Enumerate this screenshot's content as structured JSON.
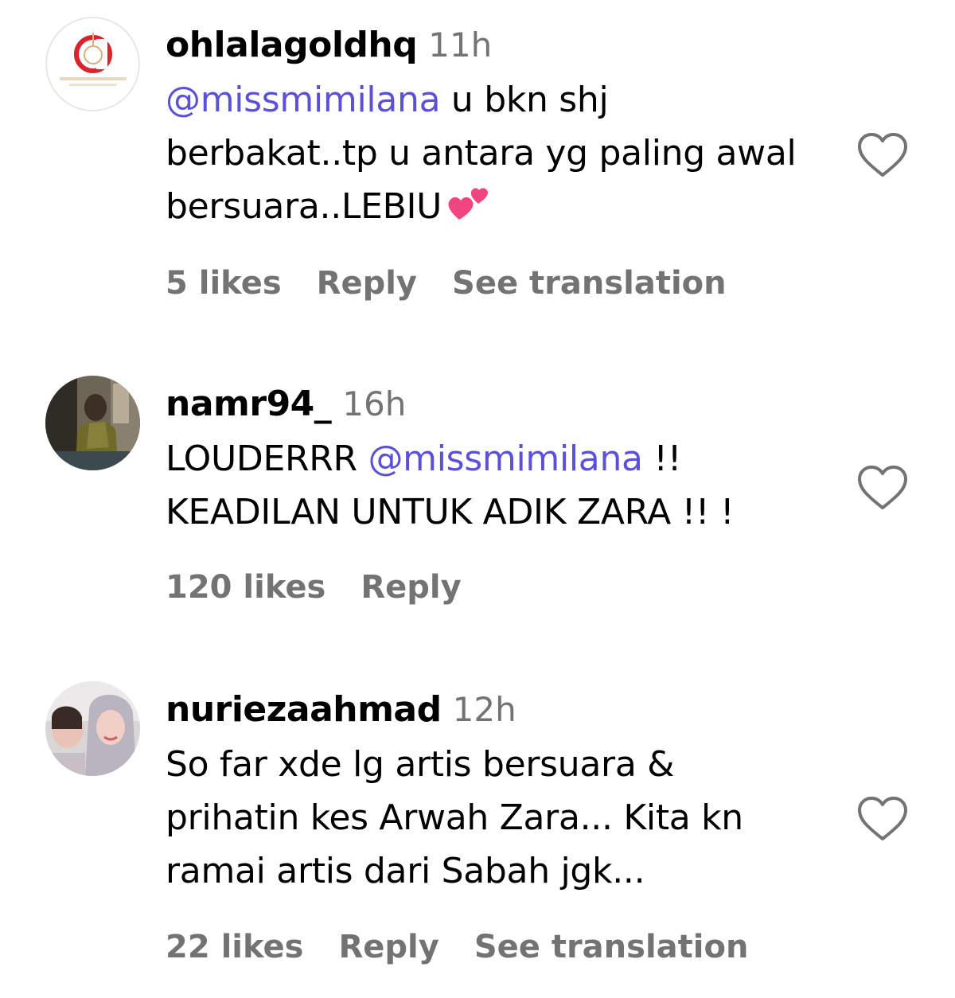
{
  "comments": [
    {
      "username": "ohlalagoldhq",
      "time": "11h",
      "mention": "@missmimilana",
      "text_after_mention": " u bkn shj",
      "line2": "berbakat..tp u antara yg paling awal",
      "line3": "bersuara..LEBIU",
      "emoji": "two-hearts",
      "likes": "5 likes",
      "reply": "Reply",
      "translation": "See translation"
    },
    {
      "username": "namr94_",
      "time": "16h",
      "text_before_mention": "LOUDERRR ",
      "mention": "@missmimilana",
      "text_after_mention": " !!",
      "line2": "KEADILAN UNTUK ADIK ZARA !! !",
      "likes": "120 likes",
      "reply": "Reply"
    },
    {
      "username": "nuriezaahmad",
      "time": "12h",
      "line1": "So far xde lg artis bersuara &",
      "line2": "prihatin kes Arwah Zara... Kita kn",
      "line3": "ramai artis dari Sabah jgk...",
      "likes": "22 likes",
      "reply": "Reply",
      "translation": "See translation"
    }
  ],
  "colors": {
    "mention": "#5b51d8",
    "secondary_text": "#737373",
    "primary_text": "#000000",
    "logo_red": "#d8242a"
  },
  "icons": [
    "heart-outline-icon",
    "two-hearts-emoji",
    "avatar-logo",
    "avatar-photo"
  ]
}
